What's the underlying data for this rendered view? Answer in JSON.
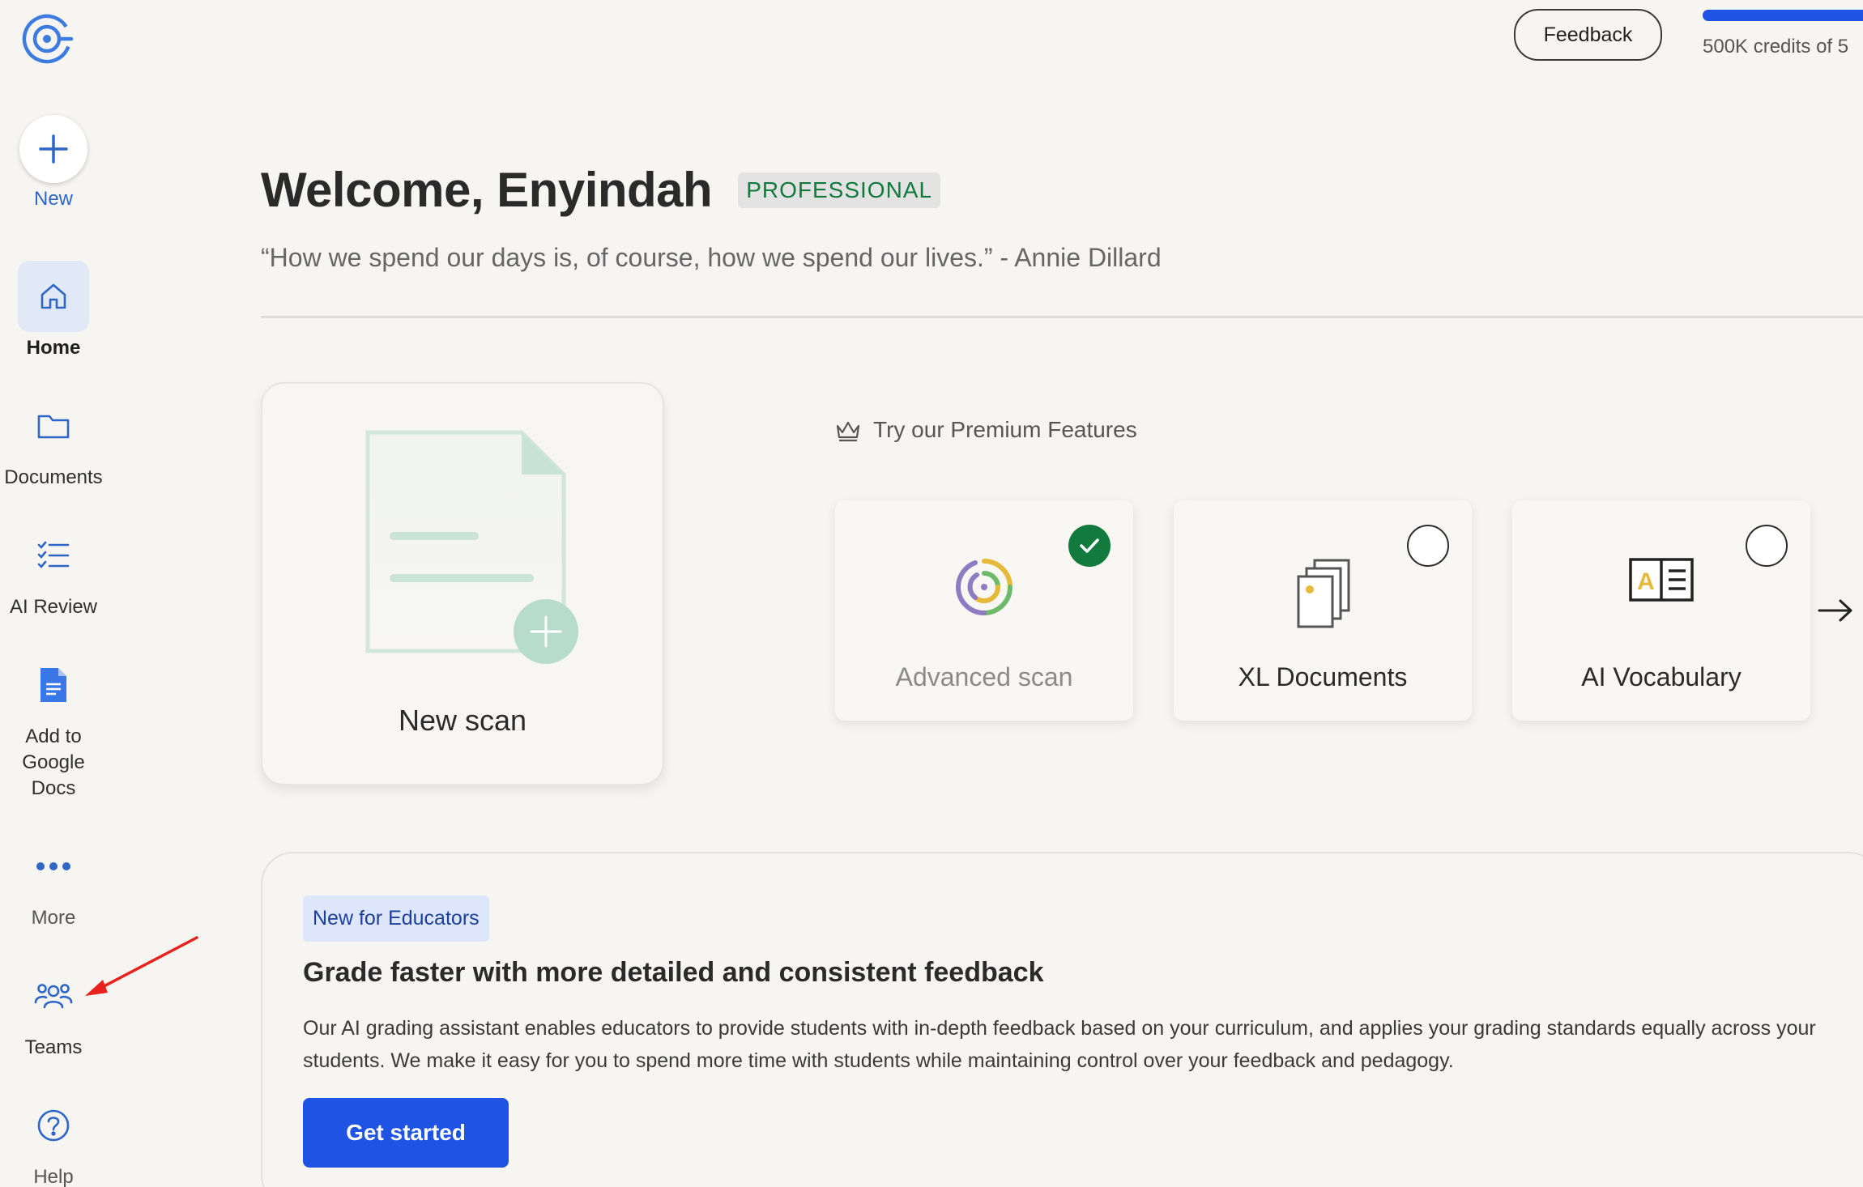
{
  "sidebar": {
    "new_label": "New",
    "items": [
      {
        "label": "Home",
        "icon": "home-icon",
        "active": true
      },
      {
        "label": "Documents",
        "icon": "folder-icon"
      },
      {
        "label": "AI Review",
        "icon": "checklist-icon"
      },
      {
        "label": "Add to\nGoogle\nDocs",
        "icon": "google-docs-icon"
      },
      {
        "label": "More",
        "icon": "more-dots-icon"
      },
      {
        "label": "Teams",
        "icon": "teams-icon"
      },
      {
        "label": "Help",
        "icon": "help-icon"
      }
    ]
  },
  "header": {
    "feedback_label": "Feedback",
    "credits_text": "500K credits of 5"
  },
  "welcome": {
    "title": "Welcome, Enyindah",
    "plan_badge": "PROFESSIONAL",
    "quote": "“How we spend our days is, of course, how we spend our lives.” - Annie Dillard"
  },
  "scan_card": {
    "label": "New scan"
  },
  "premium": {
    "title": "Try our Premium Features",
    "features": [
      {
        "label": "Advanced scan",
        "selected": true
      },
      {
        "label": "XL Documents",
        "selected": false
      },
      {
        "label": "AI Vocabulary",
        "selected": false
      }
    ]
  },
  "educators": {
    "tag": "New for Educators",
    "title": "Grade faster with more detailed and consistent feedback",
    "description": "Our AI grading assistant enables educators to provide students with in-depth feedback based on your curriculum, and applies your grading standards equally across your students. We make it easy for you to spend more time with students while maintaining control over your feedback and pedagogy.",
    "cta_label": "Get started"
  },
  "colors": {
    "accent_blue": "#1f53e3",
    "success_green": "#117a3c",
    "annotation_red": "#e8211c"
  }
}
